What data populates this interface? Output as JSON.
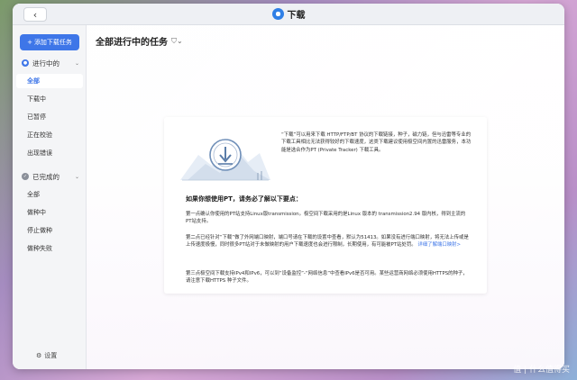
{
  "window": {
    "title": "下载"
  },
  "sidebar": {
    "add_button": "添加下载任务",
    "groups": [
      {
        "label": "进行中的",
        "items": [
          "全部",
          "下载中",
          "已暂停",
          "正在校验",
          "出现错误"
        ]
      },
      {
        "label": "已完成的",
        "items": [
          "全部",
          "做种中",
          "停止做种",
          "做种失败"
        ]
      }
    ],
    "settings": "设置"
  },
  "main": {
    "title": "全部进行中的任务",
    "intro": "“下载”可以用来下载 HTTP/FTP/BT 协议的下载链接，种子，磁力链，但与迅雷等专业的下载工具相比无法获得较好的下载速度，这类下载建议使用极空间内置的迅雷服务，本功能是选合作为PT (Private Tracker) 下载工具。",
    "notice_title": "如果你想使用PT，请务必了解以下要点：",
    "point1": "第一点确认你使用的PT站支持Linux版transmission。极空间下载采用的是Linux 版本的 transmission2.94 版内核，得到主流的PT站支持。",
    "point2": "第二点已经针对“下载”做了外网端口映射，端口号请在下载的设置中查看，默认为51413。如果没有进行端口映射，将无法上传或是上传速度极慢，同时很多PT站对于未做映射的用户下载速度也会进行限制，长期使用，有可能被PT站处罚。",
    "point2_link": "详细了解端口映射>",
    "point3": "第三点极空间下载支持IPv4和IPv6，可以到“设备监控”-“网络信息”中查看IPv6是否可用。某些运营商网络必须使用HTTPS的种子，请注意下载HTTPS 种子文件。"
  },
  "watermark": "值 | 什么值得买"
}
